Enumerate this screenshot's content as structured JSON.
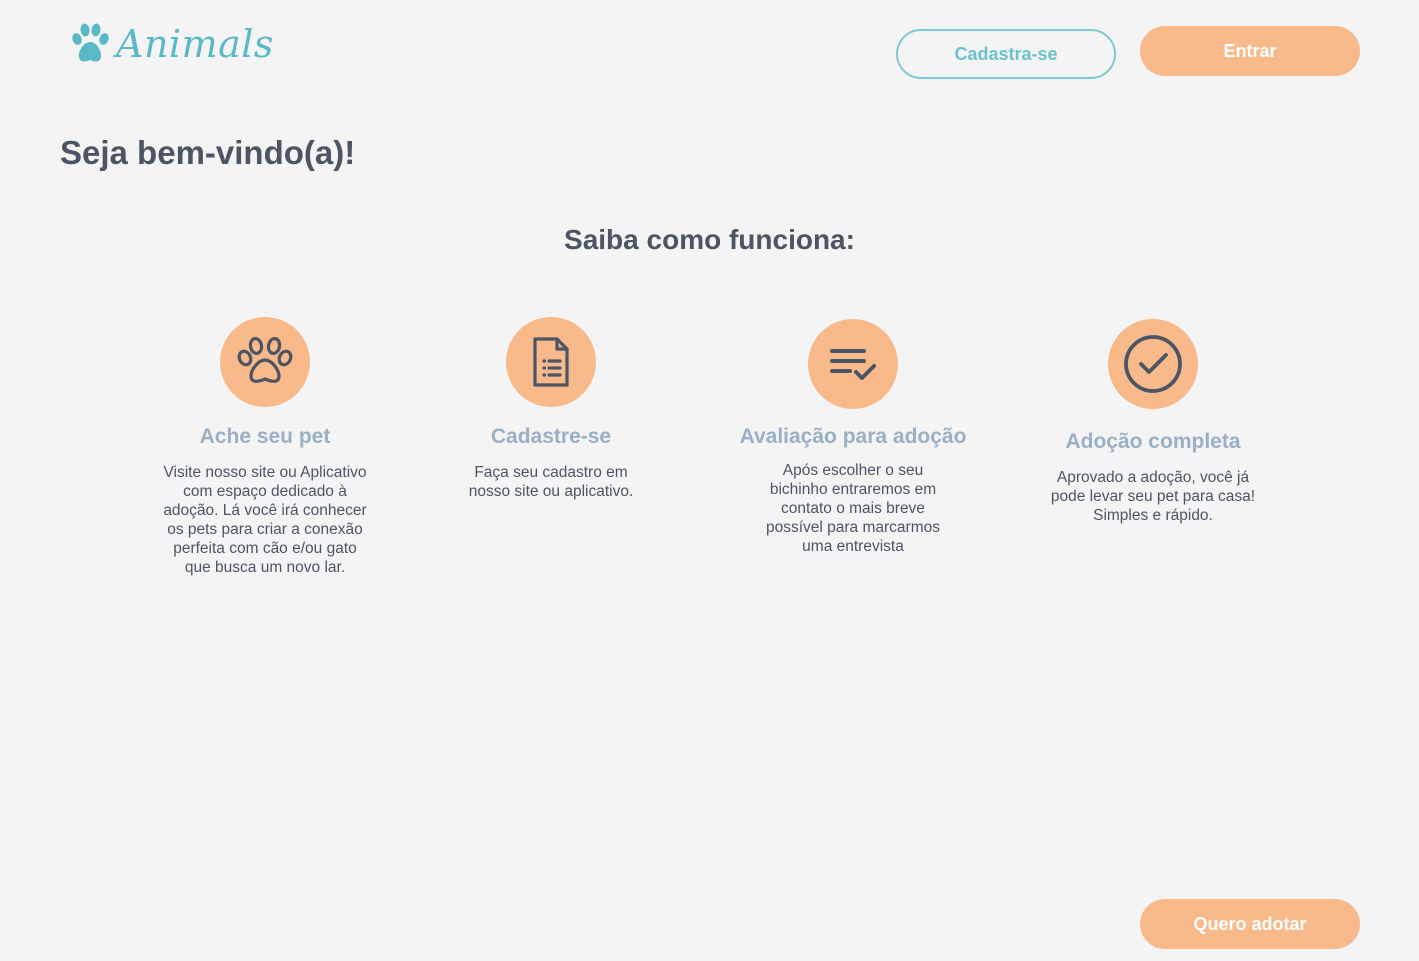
{
  "header": {
    "brand": "Animals",
    "signup_label": "Cadastra-se",
    "login_label": "Entrar"
  },
  "main": {
    "welcome": "Seja bem-vindo(a)!",
    "how_title": "Saiba como funciona:",
    "steps": [
      {
        "icon": "paw-icon",
        "title": "Ache seu pet",
        "description": "Visite nosso site ou Aplicativo com espaço dedicado à adoção. Lá você irá conhecer os pets  para criar a conexão perfeita com cão e/ou gato que busca um novo lar."
      },
      {
        "icon": "document-icon",
        "title": "Cadastre-se",
        "description": "Faça seu cadastro em nosso site ou aplicativo."
      },
      {
        "icon": "checklist-icon",
        "title": "Avaliação para adoção",
        "description": "Após escolher o seu bichinho entraremos em contato o mais breve possível para marcarmos uma entrevista"
      },
      {
        "icon": "check-circle-icon",
        "title": "Adoção completa",
        "description": "Aprovado a adoção, você já pode levar seu pet para casa! Simples e rápido."
      }
    ]
  },
  "footer": {
    "adopt_label": "Quero adotar"
  },
  "colors": {
    "background": "#f4f4f4",
    "accent_orange": "#f8b98b",
    "accent_teal": "#5ab9c6",
    "heading": "#4b5563",
    "step_title": "#9ab0c6"
  }
}
